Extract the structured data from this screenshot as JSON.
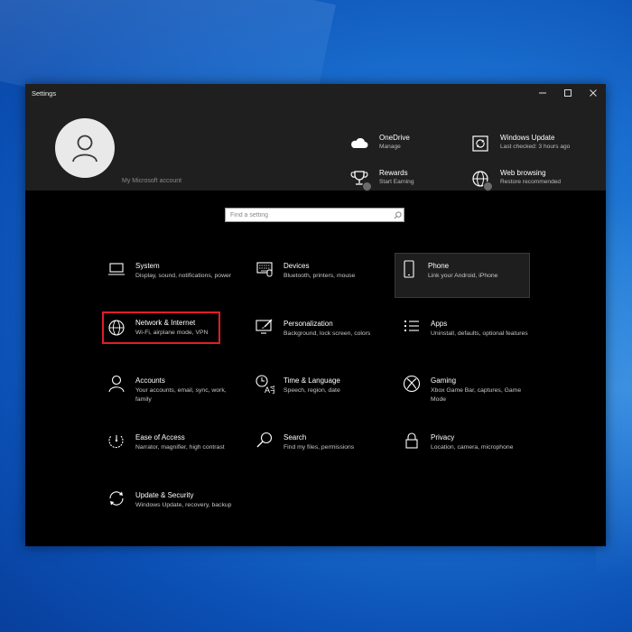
{
  "window": {
    "title": "Settings"
  },
  "header": {
    "account_link": "My Microsoft account",
    "quick_links": [
      {
        "title": "OneDrive",
        "subtitle": "Manage",
        "icon": "cloud-icon"
      },
      {
        "title": "Windows Update",
        "subtitle": "Last checked: 3 hours ago",
        "icon": "refresh-icon"
      },
      {
        "title": "Rewards",
        "subtitle": "Start Earning",
        "icon": "trophy-icon"
      },
      {
        "title": "Web browsing",
        "subtitle": "Restore recommended",
        "icon": "globe-icon"
      }
    ]
  },
  "search": {
    "placeholder": "Find a setting"
  },
  "categories": [
    {
      "name": "System",
      "desc": "Display, sound, notifications, power",
      "icon": "laptop-icon"
    },
    {
      "name": "Devices",
      "desc": "Bluetooth, printers, mouse",
      "icon": "keyboard-icon"
    },
    {
      "name": "Phone",
      "desc": "Link your Android, iPhone",
      "icon": "phone-icon"
    },
    {
      "name": "Network & Internet",
      "desc": "Wi-Fi, airplane mode, VPN",
      "icon": "globe-icon"
    },
    {
      "name": "Personalization",
      "desc": "Background, lock screen, colors",
      "icon": "paintbrush-icon"
    },
    {
      "name": "Apps",
      "desc": "Uninstall, defaults, optional features",
      "icon": "apps-list-icon"
    },
    {
      "name": "Accounts",
      "desc": "Your accounts, email, sync, work, family",
      "icon": "person-icon"
    },
    {
      "name": "Time & Language",
      "desc": "Speech, region, date",
      "icon": "time-language-icon"
    },
    {
      "name": "Gaming",
      "desc": "Xbox Game Bar, captures, Game Mode",
      "icon": "xbox-icon"
    },
    {
      "name": "Ease of Access",
      "desc": "Narrator, magnifier, high contrast",
      "icon": "ease-of-access-icon"
    },
    {
      "name": "Search",
      "desc": "Find my files, permissions",
      "icon": "magnifier-icon"
    },
    {
      "name": "Privacy",
      "desc": "Location, camera, microphone",
      "icon": "lock-icon"
    },
    {
      "name": "Update & Security",
      "desc": "Windows Update, recovery, backup",
      "icon": "sync-icon"
    }
  ],
  "colors": {
    "highlight_border": "#e01e26",
    "window_bg": "#000000",
    "header_bg": "#1f1f1f"
  }
}
